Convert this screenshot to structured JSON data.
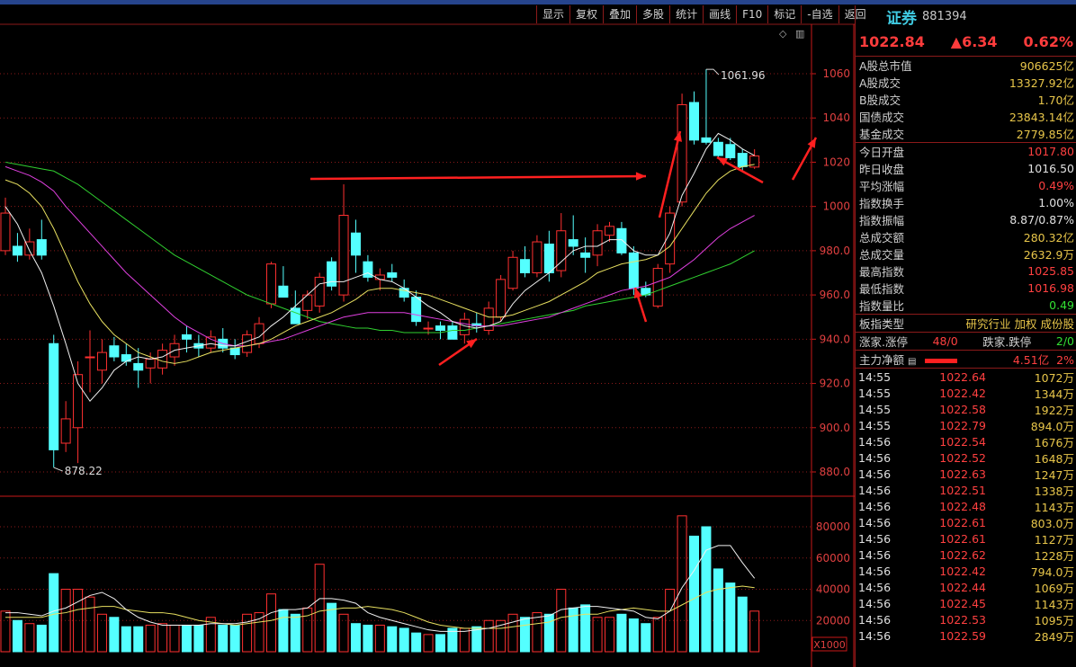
{
  "toolbar": [
    "显示",
    "复权",
    "叠加",
    "多股",
    "统计",
    "画线",
    "F10",
    "标记",
    "-自选",
    "返回"
  ],
  "chart_data": {
    "type": "candlestick",
    "price_axis": {
      "min": 870,
      "max": 1070,
      "ticks": [
        "1060",
        "1040",
        "1020",
        "1000",
        "980.0",
        "960.0",
        "940.0",
        "920.0",
        "900.0",
        "880.0"
      ],
      "tick_values": [
        1060,
        1040,
        1020,
        1000,
        980,
        960,
        940,
        920,
        900,
        880
      ]
    },
    "volume_axis": {
      "max": 90000,
      "ticks": [
        "80000",
        "60000",
        "40000",
        "20000"
      ],
      "tick_values": [
        80000,
        60000,
        40000,
        20000
      ],
      "unit": "X1000"
    },
    "high_label": "1061.96",
    "low_label": "878.22",
    "candles": [
      {
        "o": 980,
        "h": 1004,
        "l": 978,
        "c": 997
      },
      {
        "o": 982,
        "h": 988,
        "l": 975,
        "c": 978
      },
      {
        "o": 978,
        "h": 990,
        "l": 976,
        "c": 984
      },
      {
        "o": 985,
        "h": 994,
        "l": 976,
        "c": 978
      },
      {
        "o": 938,
        "h": 942,
        "l": 882,
        "c": 890
      },
      {
        "o": 893,
        "h": 912,
        "l": 889,
        "c": 904
      },
      {
        "o": 900,
        "h": 930,
        "l": 884,
        "c": 924
      },
      {
        "o": 932,
        "h": 944,
        "l": 916,
        "c": 932
      },
      {
        "o": 926,
        "h": 940,
        "l": 920,
        "c": 934
      },
      {
        "o": 937,
        "h": 941,
        "l": 930,
        "c": 932
      },
      {
        "o": 933,
        "h": 938,
        "l": 928,
        "c": 930
      },
      {
        "o": 929,
        "h": 936,
        "l": 918,
        "c": 926
      },
      {
        "o": 927,
        "h": 934,
        "l": 920,
        "c": 931
      },
      {
        "o": 927,
        "h": 938,
        "l": 924,
        "c": 935
      },
      {
        "o": 932,
        "h": 942,
        "l": 928,
        "c": 938
      },
      {
        "o": 942,
        "h": 946,
        "l": 934,
        "c": 940
      },
      {
        "o": 938,
        "h": 942,
        "l": 932,
        "c": 936
      },
      {
        "o": 936,
        "h": 944,
        "l": 934,
        "c": 941
      },
      {
        "o": 940,
        "h": 945,
        "l": 934,
        "c": 936
      },
      {
        "o": 936,
        "h": 940,
        "l": 931,
        "c": 933
      },
      {
        "o": 934,
        "h": 944,
        "l": 932,
        "c": 942
      },
      {
        "o": 938,
        "h": 950,
        "l": 936,
        "c": 947
      },
      {
        "o": 956,
        "h": 975,
        "l": 954,
        "c": 974
      },
      {
        "o": 964,
        "h": 973,
        "l": 960,
        "c": 959
      },
      {
        "o": 954,
        "h": 962,
        "l": 947,
        "c": 947
      },
      {
        "o": 953,
        "h": 962,
        "l": 949,
        "c": 960
      },
      {
        "o": 955,
        "h": 970,
        "l": 952,
        "c": 968
      },
      {
        "o": 975,
        "h": 977,
        "l": 962,
        "c": 964
      },
      {
        "o": 960,
        "h": 1010,
        "l": 957,
        "c": 996
      },
      {
        "o": 988,
        "h": 994,
        "l": 970,
        "c": 978
      },
      {
        "o": 975,
        "h": 978,
        "l": 966,
        "c": 968
      },
      {
        "o": 967,
        "h": 972,
        "l": 962,
        "c": 969
      },
      {
        "o": 970,
        "h": 974,
        "l": 966,
        "c": 968
      },
      {
        "o": 963,
        "h": 967,
        "l": 957,
        "c": 959
      },
      {
        "o": 959,
        "h": 962,
        "l": 946,
        "c": 948
      },
      {
        "o": 945,
        "h": 948,
        "l": 942,
        "c": 945
      },
      {
        "o": 946,
        "h": 948,
        "l": 940,
        "c": 944
      },
      {
        "o": 946,
        "h": 948,
        "l": 940,
        "c": 940
      },
      {
        "o": 942,
        "h": 952,
        "l": 938,
        "c": 949
      },
      {
        "o": 947,
        "h": 952,
        "l": 943,
        "c": 946
      },
      {
        "o": 944,
        "h": 957,
        "l": 942,
        "c": 954
      },
      {
        "o": 950,
        "h": 969,
        "l": 948,
        "c": 967
      },
      {
        "o": 963,
        "h": 980,
        "l": 962,
        "c": 977
      },
      {
        "o": 976,
        "h": 982,
        "l": 968,
        "c": 970
      },
      {
        "o": 970,
        "h": 987,
        "l": 968,
        "c": 984
      },
      {
        "o": 983,
        "h": 989,
        "l": 966,
        "c": 970
      },
      {
        "o": 971,
        "h": 997,
        "l": 968,
        "c": 989
      },
      {
        "o": 985,
        "h": 996,
        "l": 978,
        "c": 982
      },
      {
        "o": 979,
        "h": 986,
        "l": 970,
        "c": 977
      },
      {
        "o": 978,
        "h": 992,
        "l": 973,
        "c": 989
      },
      {
        "o": 987,
        "h": 993,
        "l": 984,
        "c": 991
      },
      {
        "o": 990,
        "h": 993,
        "l": 978,
        "c": 979
      },
      {
        "o": 979,
        "h": 982,
        "l": 960,
        "c": 963
      },
      {
        "o": 963,
        "h": 966,
        "l": 959,
        "c": 960
      },
      {
        "o": 955,
        "h": 974,
        "l": 954,
        "c": 972
      },
      {
        "o": 974,
        "h": 1000,
        "l": 970,
        "c": 997
      },
      {
        "o": 1002,
        "h": 1051,
        "l": 1000,
        "c": 1046
      },
      {
        "o": 1047,
        "h": 1052,
        "l": 1028,
        "c": 1030
      },
      {
        "o": 1031,
        "h": 1062,
        "l": 1028,
        "c": 1029
      },
      {
        "o": 1029,
        "h": 1031,
        "l": 1022,
        "c": 1023
      },
      {
        "o": 1028,
        "h": 1031,
        "l": 1021,
        "c": 1022
      },
      {
        "o": 1024,
        "h": 1026,
        "l": 1016,
        "c": 1018
      },
      {
        "o": 1017.8,
        "h": 1025.85,
        "l": 1016.98,
        "c": 1022.84
      }
    ],
    "volume": [
      26000,
      20000,
      18000,
      17000,
      50000,
      40000,
      40000,
      35000,
      24000,
      22000,
      16000,
      16000,
      17000,
      18000,
      17000,
      17000,
      17000,
      22000,
      17000,
      17000,
      24000,
      25000,
      37000,
      27000,
      24000,
      28000,
      56000,
      31000,
      24000,
      18000,
      17000,
      17000,
      16000,
      15000,
      12000,
      11000,
      11000,
      15000,
      15000,
      16000,
      20000,
      20000,
      24000,
      22000,
      25000,
      24000,
      40000,
      28000,
      30000,
      22000,
      22000,
      24000,
      21000,
      18000,
      22000,
      40000,
      87000,
      74000,
      80000,
      53000,
      44000,
      35000,
      26000
    ],
    "ma5": [
      1000,
      992,
      980,
      970,
      955,
      938,
      920,
      912,
      918,
      926,
      930,
      932,
      931,
      932,
      935,
      936,
      937,
      938,
      937,
      937,
      939,
      941,
      946,
      950,
      955,
      960,
      965,
      966,
      966,
      968,
      970,
      967,
      966,
      963,
      959,
      955,
      952,
      948,
      946,
      945,
      946,
      948,
      956,
      962,
      966,
      970,
      975,
      980,
      982,
      982,
      985,
      985,
      980,
      978,
      978,
      988,
      1005,
      1015,
      1026,
      1033,
      1030,
      1026,
      1023
    ],
    "ma10": [
      1012,
      1010,
      1006,
      1000,
      990,
      978,
      966,
      956,
      948,
      942,
      938,
      934,
      932,
      930,
      929,
      930,
      932,
      934,
      935,
      936,
      937,
      938,
      940,
      943,
      946,
      948,
      950,
      952,
      955,
      958,
      962,
      963,
      963,
      962,
      961,
      960,
      958,
      956,
      954,
      952,
      950,
      950,
      951,
      953,
      955,
      957,
      960,
      963,
      966,
      970,
      972,
      974,
      975,
      976,
      978,
      982,
      990,
      998,
      1006,
      1012,
      1016,
      1018,
      1019
    ],
    "ma20": [
      1018,
      1016,
      1014,
      1011,
      1007,
      1000,
      994,
      988,
      982,
      976,
      970,
      965,
      960,
      955,
      950,
      946,
      943,
      940,
      938,
      937,
      937,
      938,
      939,
      940,
      942,
      944,
      946,
      948,
      950,
      951,
      952,
      952,
      952,
      952,
      951,
      950,
      949,
      948,
      947,
      946,
      946,
      946,
      947,
      948,
      949,
      950,
      952,
      954,
      956,
      958,
      960,
      962,
      963,
      964,
      966,
      968,
      972,
      976,
      981,
      986,
      990,
      993,
      996
    ],
    "ma60": [
      1020,
      1019,
      1018,
      1017,
      1016,
      1013,
      1010,
      1006,
      1002,
      998,
      994,
      990,
      986,
      982,
      978,
      975,
      972,
      969,
      966,
      963,
      960,
      958,
      956,
      954,
      952,
      950,
      948,
      947,
      946,
      945,
      945,
      944,
      944,
      943,
      943,
      943,
      943,
      944,
      944,
      945,
      946,
      947,
      948,
      949,
      950,
      951,
      952,
      953,
      955,
      956,
      957,
      958,
      959,
      960,
      962,
      964,
      966,
      968,
      970,
      972,
      974,
      977,
      980
    ],
    "vol_ma5": [
      25000,
      25000,
      24000,
      23000,
      26000,
      28000,
      32000,
      36000,
      38000,
      34000,
      27000,
      22000,
      19000,
      17000,
      17000,
      17000,
      17000,
      18000,
      18000,
      18000,
      19000,
      21000,
      25000,
      27000,
      27000,
      28000,
      34000,
      34000,
      33000,
      31000,
      25000,
      22000,
      20000,
      18000,
      16000,
      14000,
      13000,
      13000,
      13000,
      14000,
      15000,
      17000,
      19000,
      21000,
      22000,
      23000,
      27000,
      28000,
      29000,
      29000,
      28000,
      27000,
      26000,
      22000,
      21000,
      26000,
      41000,
      52000,
      65000,
      68000,
      68000,
      57000,
      47000
    ],
    "vol_ma10": [
      22000,
      22000,
      22000,
      22000,
      24000,
      25000,
      27000,
      28000,
      29000,
      29000,
      27000,
      26000,
      25000,
      25000,
      24000,
      22000,
      20000,
      19000,
      18000,
      17000,
      18000,
      19000,
      20000,
      22000,
      22000,
      23000,
      26000,
      27000,
      28000,
      28000,
      29000,
      28000,
      27000,
      25000,
      22000,
      19000,
      17000,
      16000,
      15000,
      15000,
      15000,
      15000,
      16000,
      17000,
      18000,
      19000,
      22000,
      23000,
      24000,
      24000,
      26000,
      27000,
      28000,
      27000,
      26000,
      26000,
      30000,
      34000,
      38000,
      40000,
      41000,
      42000,
      41000
    ]
  },
  "quote": {
    "name": "证券",
    "code": "881394",
    "price": "1022.84",
    "change": "▲6.34",
    "pct": "0.62%"
  },
  "stats1": [
    {
      "label": "A股总市值",
      "value": "906625亿"
    },
    {
      "label": "A股成交",
      "value": "13327.92亿"
    },
    {
      "label": "B股成交",
      "value": "1.70亿"
    },
    {
      "label": "国债成交",
      "value": "23843.14亿"
    },
    {
      "label": "基金成交",
      "value": "2779.85亿"
    }
  ],
  "stats2": [
    {
      "label": "今日开盘",
      "value": "1017.80"
    },
    {
      "label": "昨日收盘",
      "value": "1016.50"
    },
    {
      "label": "平均涨幅",
      "value": "0.49%"
    },
    {
      "label": "指数换手",
      "value": "1.00%"
    },
    {
      "label": "指数振幅",
      "value": "8.87/0.87%"
    },
    {
      "label": "总成交额",
      "value": "280.32亿"
    },
    {
      "label": "总成交量",
      "value": "2632.9万"
    },
    {
      "label": "最高指数",
      "value": "1025.85"
    },
    {
      "label": "最低指数",
      "value": "1016.98"
    },
    {
      "label": "指数量比",
      "value": "0.49"
    }
  ],
  "board": {
    "label": "板指类型",
    "value": "研究行业 加权 成份股"
  },
  "limits": {
    "up_label": "涨家.涨停",
    "up_value": "48/0",
    "down_label": "跌家.跌停",
    "down_value": "2/0"
  },
  "netflow": {
    "label": "主力净额",
    "value": "4.51亿",
    "pct": "2%"
  },
  "ticks": [
    {
      "time": "14:55",
      "price": "1022.64",
      "vol": "1072万"
    },
    {
      "time": "14:55",
      "price": "1022.42",
      "vol": "1344万"
    },
    {
      "time": "14:55",
      "price": "1022.58",
      "vol": "1922万"
    },
    {
      "time": "14:55",
      "price": "1022.79",
      "vol": "894.0万"
    },
    {
      "time": "14:56",
      "price": "1022.54",
      "vol": "1676万"
    },
    {
      "time": "14:56",
      "price": "1022.52",
      "vol": "1648万"
    },
    {
      "time": "14:56",
      "price": "1022.63",
      "vol": "1247万"
    },
    {
      "time": "14:56",
      "price": "1022.51",
      "vol": "1338万"
    },
    {
      "time": "14:56",
      "price": "1022.48",
      "vol": "1143万"
    },
    {
      "time": "14:56",
      "price": "1022.61",
      "vol": "803.0万"
    },
    {
      "time": "14:56",
      "price": "1022.61",
      "vol": "1127万"
    },
    {
      "time": "14:56",
      "price": "1022.62",
      "vol": "1228万"
    },
    {
      "time": "14:56",
      "price": "1022.42",
      "vol": "794.0万"
    },
    {
      "time": "14:56",
      "price": "1022.44",
      "vol": "1069万"
    },
    {
      "time": "14:56",
      "price": "1022.45",
      "vol": "1143万"
    },
    {
      "time": "14:56",
      "price": "1022.53",
      "vol": "1095万"
    },
    {
      "time": "14:56",
      "price": "1022.59",
      "vol": "2849万"
    }
  ],
  "colors": {
    "up": "#ff3030",
    "down": "#54ffff",
    "ma5": "#f0f0f0",
    "ma10": "#e8e060",
    "ma20": "#e040e0",
    "ma60": "#30d030",
    "grid": "#8b1a1a",
    "axis": "#c81818",
    "arrow": "#ff2020"
  }
}
